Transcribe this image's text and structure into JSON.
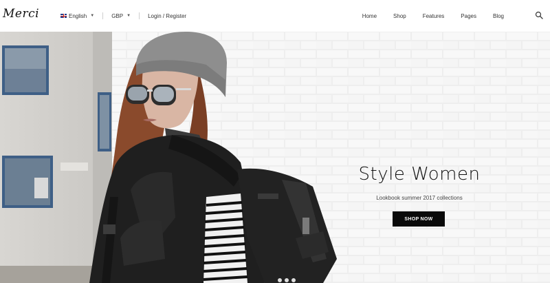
{
  "logo": {
    "text": "Merci"
  },
  "topbar": {
    "language": "English",
    "currency": "GBP",
    "account": "Login / Register"
  },
  "nav": {
    "items": [
      {
        "label": "Home"
      },
      {
        "label": "Shop"
      },
      {
        "label": "Features"
      },
      {
        "label": "Pages"
      },
      {
        "label": "Blog"
      }
    ]
  },
  "hero": {
    "title": "Style Women",
    "subtitle": "Lookbook summer 2017 collections",
    "button_label": "SHOP NOW",
    "slide_count": 3,
    "active_slide": 1
  },
  "colors": {
    "header_bg": "#ffffff",
    "button_bg": "#0a0a0a",
    "button_text": "#ffffff",
    "text_dark": "#111111"
  },
  "icons": {
    "search": "search-icon",
    "flag": "uk-flag-icon",
    "dropdown": "chevron-down-icon"
  }
}
